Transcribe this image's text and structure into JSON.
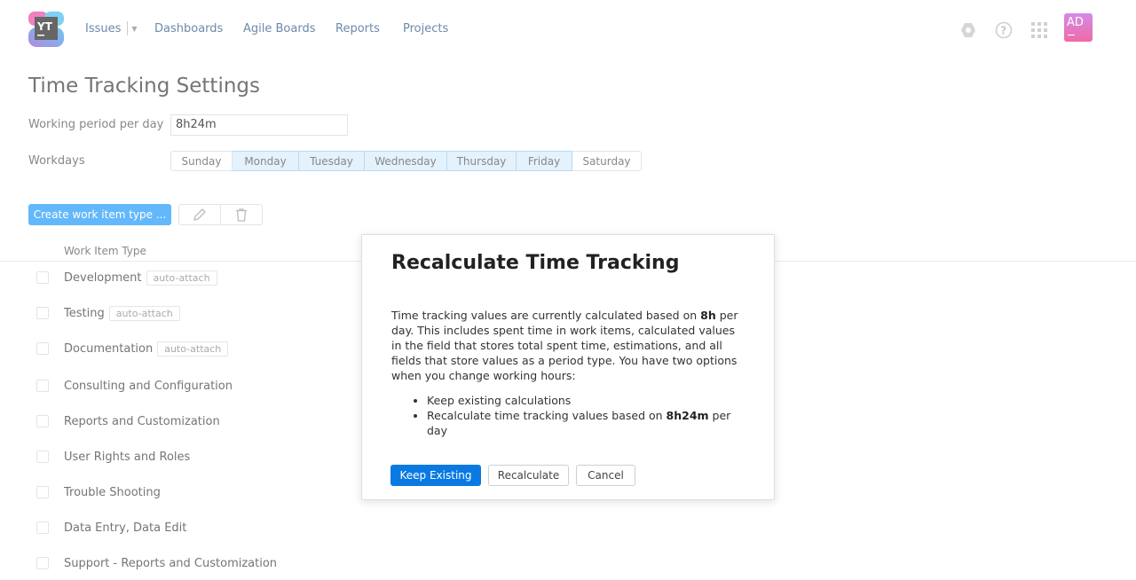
{
  "header": {
    "logo_text": "YT",
    "nav": [
      "Issues",
      "Dashboards",
      "Agile Boards",
      "Reports",
      "Projects"
    ],
    "avatar": "AD"
  },
  "page": {
    "title": "Time Tracking Settings",
    "working_period_label": "Working period per day",
    "working_period_value": "8h24m",
    "workdays_label": "Workdays",
    "days": [
      {
        "label": "Sunday",
        "on": false
      },
      {
        "label": "Monday",
        "on": true
      },
      {
        "label": "Tuesday",
        "on": true
      },
      {
        "label": "Wednesday",
        "on": true
      },
      {
        "label": "Thursday",
        "on": true
      },
      {
        "label": "Friday",
        "on": true
      },
      {
        "label": "Saturday",
        "on": false
      }
    ],
    "create_button": "Create work item type ...",
    "column_header": "Work Item Type",
    "rows": [
      {
        "name": "Development",
        "tag": "auto-attach"
      },
      {
        "name": "Testing",
        "tag": "auto-attach"
      },
      {
        "name": "Documentation",
        "tag": "auto-attach"
      },
      {
        "name": "Consulting and Configuration"
      },
      {
        "name": "Reports and Customization"
      },
      {
        "name": "User Rights and Roles"
      },
      {
        "name": "Trouble Shooting"
      },
      {
        "name": "Data Entry, Data Edit"
      },
      {
        "name": "Support - Reports and Customization"
      }
    ]
  },
  "dialog": {
    "title": "Recalculate Time Tracking",
    "p1": "Time tracking values are currently calculated based on ",
    "p1_bold": "8h",
    "p1_end": " per day. This includes spent time in work items, calculated values in the field that stores total spent time, estimations, and all fields that store values as a period type. You have two options when you change working hours:",
    "option1": "Keep existing calculations",
    "option2": "Recalculate time tracking values based on ",
    "option2_bold": "8h24m",
    "option2_end": " per day",
    "keep_button": "Keep Existing",
    "recalc_button": "Recalculate",
    "cancel_button": "Cancel"
  }
}
